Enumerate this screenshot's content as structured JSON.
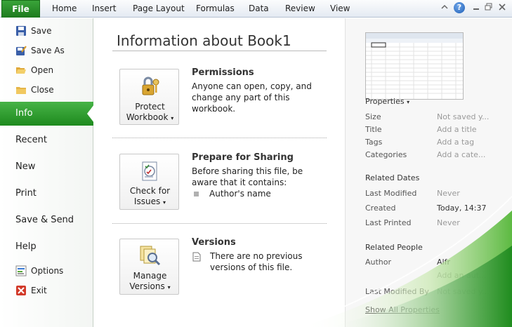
{
  "ribbon": {
    "file_tab": "File",
    "tabs": [
      "Home",
      "Insert",
      "Page Layout",
      "Formulas",
      "Data",
      "Review",
      "View"
    ],
    "help": "?"
  },
  "nav": {
    "save": "Save",
    "save_as": "Save As",
    "open": "Open",
    "close": "Close",
    "info": "Info",
    "recent": "Recent",
    "new": "New",
    "print": "Print",
    "save_send": "Save & Send",
    "help": "Help",
    "options": "Options",
    "exit": "Exit"
  },
  "main": {
    "title": "Information about Book1",
    "permissions": {
      "button_line1": "Protect",
      "button_line2": "Workbook",
      "heading": "Permissions",
      "text": "Anyone can open, copy, and change any part of this workbook."
    },
    "sharing": {
      "button_line1": "Check for",
      "button_line2": "Issues",
      "heading": "Prepare for Sharing",
      "text": "Before sharing this file, be aware that it contains:",
      "bullet": "Author's name"
    },
    "versions": {
      "button_line1": "Manage",
      "button_line2": "Versions",
      "heading": "Versions",
      "text": "There are no previous versions of this file."
    }
  },
  "properties": {
    "heading": "Properties",
    "size_label": "Size",
    "size_value": "Not saved y...",
    "title_label": "Title",
    "title_value": "Add a title",
    "tags_label": "Tags",
    "tags_value": "Add a tag",
    "categories_label": "Categories",
    "categories_value": "Add a cate...",
    "related_dates": "Related Dates",
    "last_modified_label": "Last Modified",
    "last_modified_value": "Never",
    "created_label": "Created",
    "created_value": "Today, 14:37",
    "last_printed_label": "Last Printed",
    "last_printed_value": "Never",
    "related_people": "Related People",
    "author_label": "Author",
    "author_value": "Alfr",
    "add_author": "Add an aut...",
    "last_modified_by_label": "Last Modified By",
    "last_modified_by_value": "Not saved y...",
    "show_all": "Show All Properties"
  },
  "colors": {
    "accent_green": "#1e8a1e",
    "file_tab": "#2a8f2a"
  }
}
